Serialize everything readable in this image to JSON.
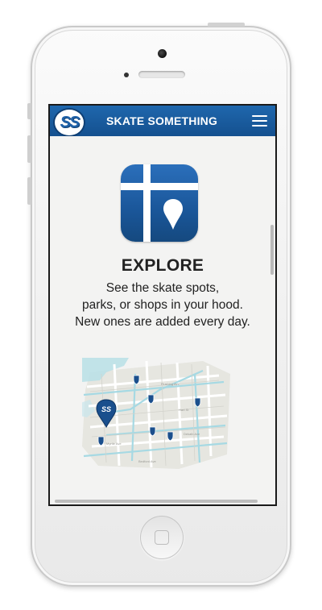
{
  "app": {
    "logo_text": "SS",
    "title": "SKATE SOMETHING"
  },
  "navbar": {
    "menu_icon": "hamburger-menu-icon",
    "color": "#1a5c9f"
  },
  "feature": {
    "icon": "map-explore-icon",
    "heading": "EXPLORE",
    "description_lines": [
      "See the skate spots,",
      "parks, or shops in your hood.",
      "New ones are added every day."
    ]
  },
  "map": {
    "streets": [
      "Flushing Ave",
      "Myrtle Ave",
      "Hart St",
      "Dekalb Ave",
      "Bedford Ave"
    ],
    "pin_label": "SS",
    "marker_icon": "shield-marker-icon"
  },
  "colors": {
    "brand_blue": "#1f67ad",
    "map_water": "#b7dfe6",
    "background": "#f3f3f2"
  }
}
